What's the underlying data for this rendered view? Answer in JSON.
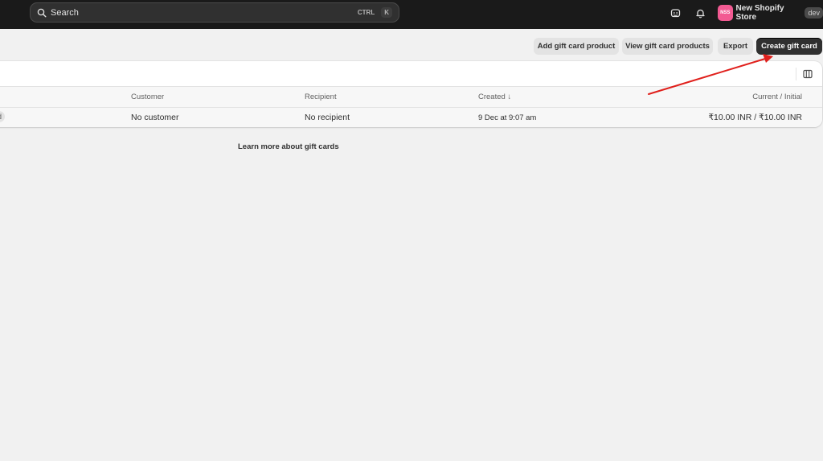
{
  "topbar": {
    "search_placeholder": "Search",
    "shortcut_ctrl": "CTRL",
    "shortcut_k": "K",
    "store_initials": "NSS",
    "store_name": "New Shopify Store",
    "store_badge": "dev"
  },
  "actions": {
    "add_gift_card_product": "Add gift card product",
    "view_gift_card_products": "View gift card products",
    "export": "Export",
    "create_gift_card": "Create gift card"
  },
  "table": {
    "headers": {
      "customer": "Customer",
      "recipient": "Recipient",
      "created": "Created",
      "sort_indicator": "↓",
      "balance": "Current / Initial"
    },
    "rows": [
      {
        "status": "d",
        "customer": "No customer",
        "recipient": "No recipient",
        "created": "9 Dec at 9:07 am",
        "balance": "₹10.00 INR / ₹10.00 INR"
      }
    ]
  },
  "footer": {
    "learn_more": "Learn more about gift cards"
  },
  "colors": {
    "topbar_bg": "#1a1a1a",
    "primary_button": "#303030",
    "avatar": "#f25a92",
    "annotation_arrow": "#e0201c"
  },
  "icons": {
    "search": "search-icon",
    "chat": "chat-icon",
    "bell": "bell-icon",
    "columns": "columns-icon"
  }
}
